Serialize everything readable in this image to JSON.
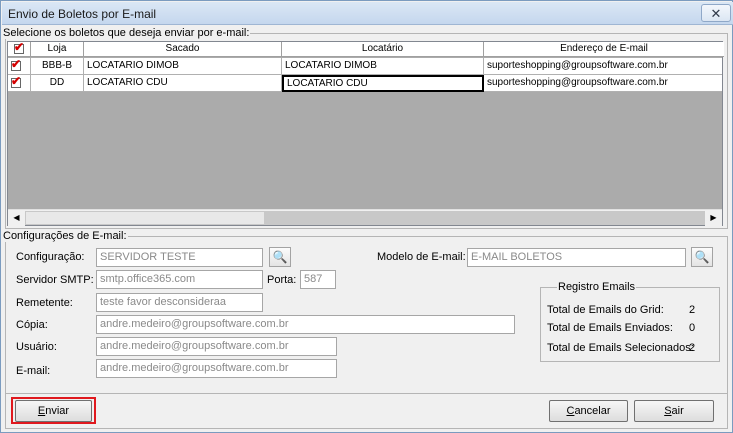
{
  "window": {
    "title": "Envio de Boletos por E-mail",
    "close_glyph": "✕"
  },
  "select_section": {
    "legend": "Selecione os boletos que deseja enviar por e-mail:"
  },
  "grid": {
    "check_header": "✔",
    "columns": [
      "Loja",
      "Sacado",
      "Locatário",
      "Endereço de E-mail"
    ],
    "rows": [
      {
        "checked": "✔",
        "loja": "BBB-B",
        "sacado": "LOCATARIO DIMOB",
        "locatario": "LOCATARIO DIMOB",
        "email": "suporteshopping@groupsoftware.com.br"
      },
      {
        "checked": "✔",
        "loja": "DD",
        "sacado": "LOCATARIO CDU",
        "locatario": "LOCATARIO CDU",
        "email": "suporteshopping@groupsoftware.com.br"
      }
    ],
    "scroll_left": "◀",
    "scroll_right": "▶"
  },
  "config": {
    "legend": "Configurações de E-mail:",
    "configuracao": {
      "label": "Configuração:",
      "value": "SERVIDOR TESTE"
    },
    "servidor": {
      "label": "Servidor SMTP:",
      "value": "smtp.office365.com"
    },
    "porta": {
      "label": "Porta:",
      "value": "587"
    },
    "remetente": {
      "label": "Remetente:",
      "value": "teste favor desconsideraa"
    },
    "copia": {
      "label": "Cópia:",
      "value": "andre.medeiro@groupsoftware.com.br"
    },
    "usuario": {
      "label": "Usuário:",
      "value": "andre.medeiro@groupsoftware.com.br"
    },
    "email": {
      "label": "E-mail:",
      "value": "andre.medeiro@groupsoftware.com.br"
    },
    "modelo": {
      "label": "Modelo de E-mail:",
      "value": "E-MAIL BOLETOS"
    },
    "search_glyph": "🔍"
  },
  "registro": {
    "legend": "Registro Emails",
    "grid_label": "Total de Emails do Grid:",
    "grid_value": "2",
    "enviados_label": "Total de Emails Enviados:",
    "enviados_value": "0",
    "selecionados_label": "Total de Emails Selecionados:",
    "selecionados_value": "2"
  },
  "buttons": {
    "enviar_u": "E",
    "enviar_rest": "nviar",
    "cancelar_u": "C",
    "cancelar_rest": "ancelar",
    "sair_u": "S",
    "sair_rest": "air"
  },
  "colors": {
    "highlight": "#e0191e",
    "grid_empty": "#ababab",
    "title_gradient": "#c5d7ee"
  }
}
